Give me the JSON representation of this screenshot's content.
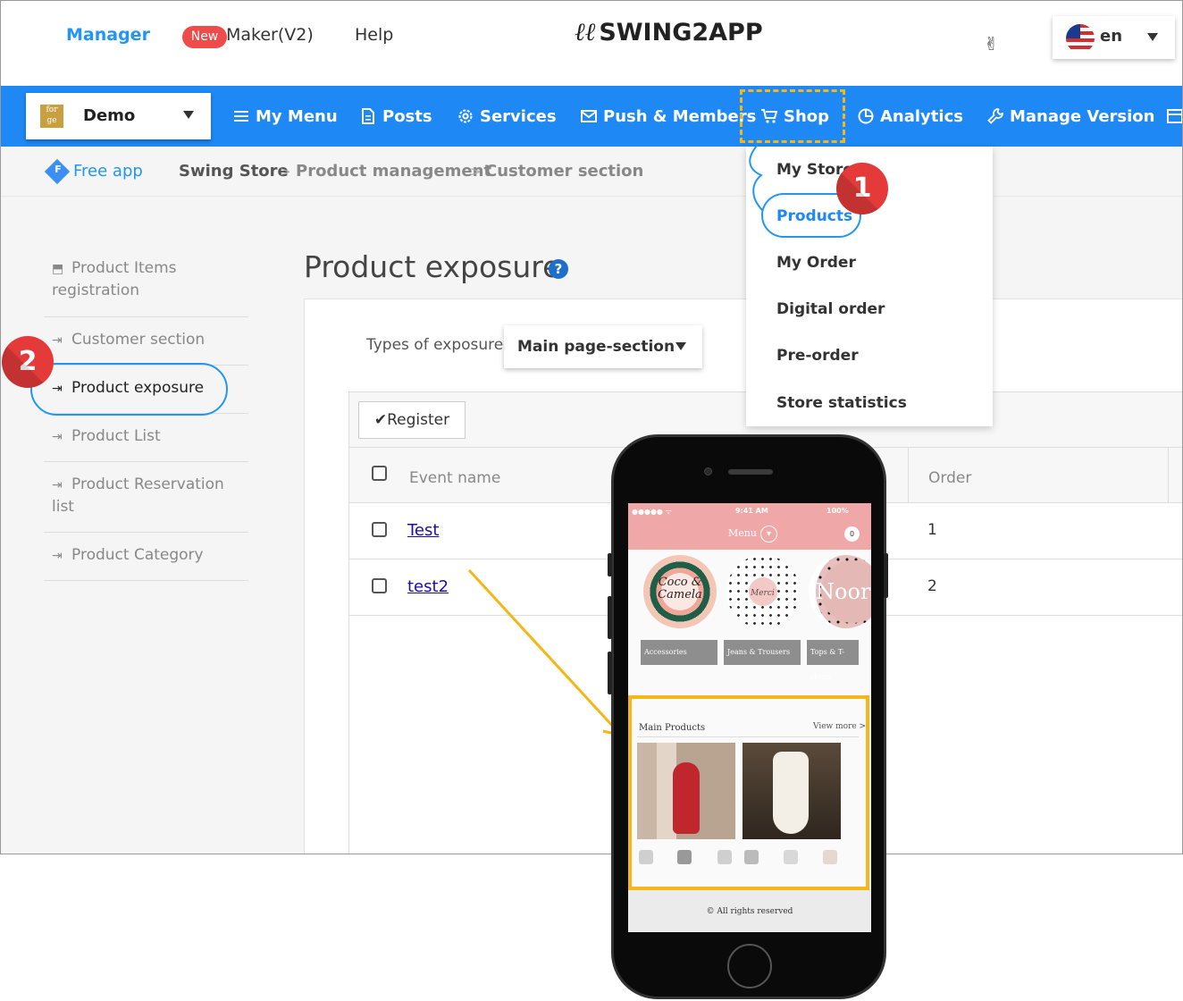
{
  "header": {
    "manager": "Manager",
    "new_badge": "New",
    "maker": "Maker(V2)",
    "help": "Help",
    "logo_mark": "ℓℓ",
    "logo_text": "SWING2APP",
    "language": "en"
  },
  "navbar": {
    "app_name": "Demo",
    "app_thumb": "for ge",
    "items": [
      "My Menu",
      "Posts",
      "Services",
      "Push & Members",
      "Shop",
      "Analytics",
      "Manage Version"
    ]
  },
  "breadcrumb": {
    "badge": "F",
    "free_app": "Free app",
    "crumbs": [
      "Swing Store",
      "Product management",
      "Customer section"
    ],
    "separator": ">"
  },
  "sidebar": {
    "items": [
      "Product Items registration",
      "Customer section",
      "Product exposure",
      "Product List",
      "Product Reservation list",
      "Product Category"
    ]
  },
  "main": {
    "title": "Product exposure",
    "help_glyph": "?",
    "types_label": "Types of exposure",
    "types_value": "Main page-section",
    "register": "✔Register",
    "columns": {
      "event": "Event name",
      "order": "Order"
    },
    "rows": [
      {
        "name": "Test",
        "order": "1"
      },
      {
        "name": "test2",
        "order": "2"
      }
    ]
  },
  "shop_menu": {
    "items": [
      "My Store",
      "Products",
      "My Order",
      "Digital order",
      "Pre-order",
      "Store statistics"
    ]
  },
  "badges": {
    "step1": "1",
    "step2": "2"
  },
  "phone": {
    "signal": "●●●●● ᯤ",
    "time": "9:41 AM",
    "battery": "100%",
    "menu": "Menu",
    "cart": "0",
    "categories": [
      "Accessories",
      "Jeans & Trousers",
      "Tops & T-shirts"
    ],
    "cat_words": {
      "coco": "Coco & Camela",
      "merci": "Merci",
      "noor": "Noor"
    },
    "main_products": "Main Products",
    "view_more": "View more >",
    "footer": "© All rights reserved"
  },
  "colors": {
    "nav_blue": "#1e88f5",
    "accent_yellow": "#f5b617",
    "badge_red": "#e53a3a"
  }
}
